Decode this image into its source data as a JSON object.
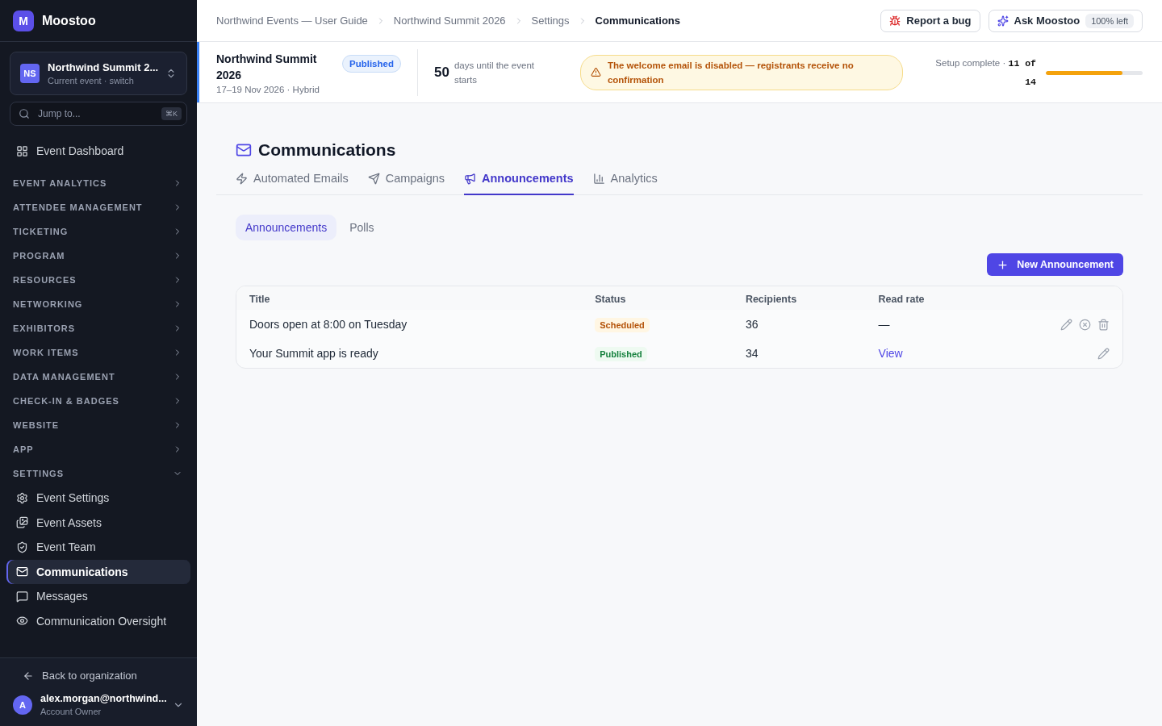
{
  "brand": {
    "logo": "M",
    "name": "Moostoo"
  },
  "event_switcher": {
    "initials": "NS",
    "name": "Northwind Summit 2...",
    "caption": "Current event · switch"
  },
  "jump": {
    "placeholder": "Jump to...",
    "shortcut": "⌘K"
  },
  "dashboard": {
    "label": "Event Dashboard",
    "selected": false
  },
  "nav": [
    {
      "label": "EVENT ANALYTICS",
      "expanded": false
    },
    {
      "label": "ATTENDEE MANAGEMENT",
      "expanded": false
    },
    {
      "label": "TICKETING",
      "expanded": false
    },
    {
      "label": "PROGRAM",
      "expanded": false
    },
    {
      "label": "RESOURCES",
      "expanded": false
    },
    {
      "label": "NETWORKING",
      "expanded": false
    },
    {
      "label": "EXHIBITORS",
      "expanded": false
    },
    {
      "label": "WORK ITEMS",
      "expanded": false
    },
    {
      "label": "DATA MANAGEMENT",
      "expanded": false
    },
    {
      "label": "CHECK-IN & BADGES",
      "expanded": false
    },
    {
      "label": "WEBSITE",
      "expanded": false
    },
    {
      "label": "APP",
      "expanded": false
    },
    {
      "label": "SETTINGS",
      "expanded": true,
      "children": [
        {
          "label": "Event Settings",
          "selected": false
        },
        {
          "label": "Event Assets",
          "selected": false
        },
        {
          "label": "Event Team",
          "selected": false
        },
        {
          "label": "Communications",
          "selected": true
        },
        {
          "label": "Messages",
          "selected": false
        },
        {
          "label": "Communication Oversight",
          "selected": false
        }
      ]
    }
  ],
  "back_link": "Back to organization",
  "user": {
    "initial": "A",
    "email": "alex.morgan@northwind...",
    "role": "Account Owner"
  },
  "breadcrumbs": [
    "Northwind Events — User Guide",
    "Northwind Summit 2026",
    "Settings",
    "Communications"
  ],
  "top_buttons": {
    "report": "Report a bug",
    "ask": "Ask Moostoo",
    "ask_badge": "100% left"
  },
  "event_bar": {
    "title": "Northwind Summit 2026",
    "status": "Published",
    "dates": "17–19 Nov 2026 · Hybrid",
    "days": "50",
    "days_caption": "days until the event starts",
    "warning": "The welcome email is disabled — registrants receive no confirmation",
    "setup_label": "Setup complete ·",
    "setup_count": "11 of 14",
    "level": 0.79
  },
  "page": {
    "title": "Communications"
  },
  "tabs": [
    {
      "label": "Automated Emails",
      "selected": false
    },
    {
      "label": "Campaigns",
      "selected": false
    },
    {
      "label": "Announcements",
      "selected": true
    },
    {
      "label": "Analytics",
      "selected": false
    }
  ],
  "subtabs": [
    {
      "label": "Announcements",
      "selected": true
    },
    {
      "label": "Polls",
      "selected": false
    }
  ],
  "new_button": "New Announcement",
  "table": {
    "columns": [
      "Title",
      "Status",
      "Recipients",
      "Read rate"
    ],
    "rows": [
      {
        "title": "Doors open at 8:00 on Tuesday",
        "status": {
          "label": "Scheduled",
          "kind": "scheduled"
        },
        "recipients": "36",
        "read_rate": {
          "text": "—",
          "kind": "text"
        },
        "actions": [
          {
            "kind": "edit"
          },
          {
            "kind": "cancel"
          },
          {
            "kind": "delete"
          }
        ]
      },
      {
        "title": "Your Summit app is ready",
        "status": {
          "label": "Published",
          "kind": "published"
        },
        "recipients": "34",
        "read_rate": {
          "text": "View",
          "kind": "link"
        },
        "actions": [
          {
            "kind": "edit"
          }
        ]
      }
    ]
  }
}
